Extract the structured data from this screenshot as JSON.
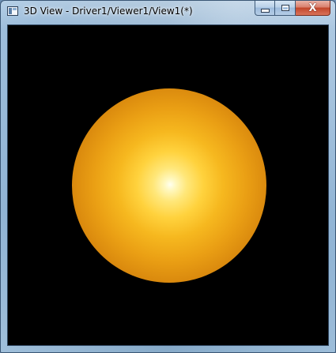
{
  "window": {
    "title": "3D View - Driver1/Viewer1/View1(*)",
    "icon": "app-window-icon",
    "controls": {
      "minimize_icon": "minimize-icon",
      "maximize_icon": "maximize-icon",
      "close_label": "X"
    }
  },
  "viewport": {
    "background_color": "#000000",
    "object": {
      "shape": "sphere",
      "color": "#f0b020",
      "highlight_color": "#fffff0"
    }
  }
}
